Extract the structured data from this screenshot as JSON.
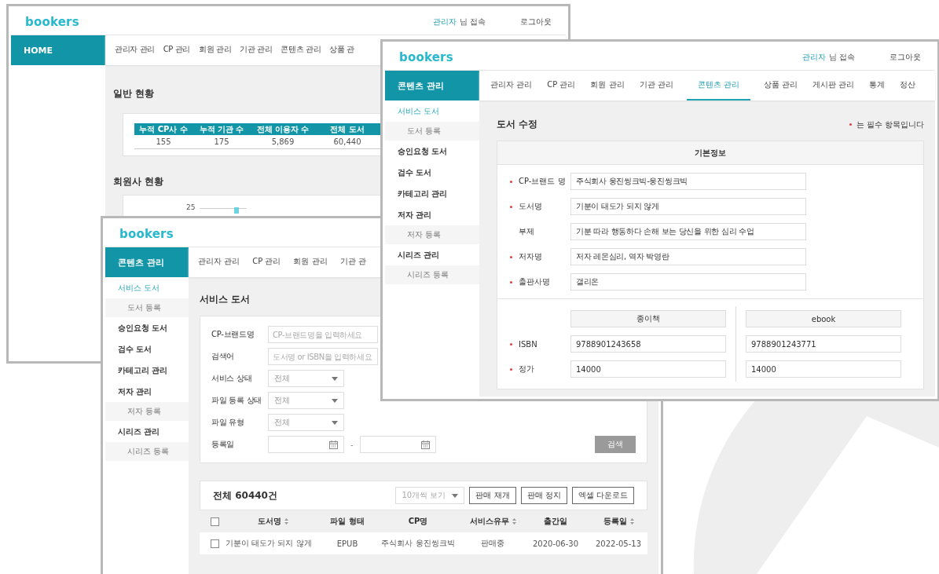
{
  "windows": [
    {
      "kind": "dashboard",
      "header": {
        "logo": "bookers",
        "user": "관리자",
        "user_suffix": "님 접속",
        "logout": "로그아웃"
      },
      "section_title": "HOME",
      "nav": [
        {
          "label": "관리자 관리",
          "selected": false
        },
        {
          "label": "CP 관리",
          "selected": false
        },
        {
          "label": "회원 관리",
          "selected": false
        },
        {
          "label": "기관 관리",
          "selected": false
        },
        {
          "label": "콘텐츠 관리",
          "selected": false
        },
        {
          "label": "상품 관",
          "selected": false
        }
      ],
      "general": {
        "title": "일반 현황",
        "columns": [
          "누적 CP사 수",
          "누적 기관 수",
          "전체 이용자 수",
          "전체 도서"
        ],
        "values": [
          "155",
          "175",
          "5,869",
          "60,440"
        ]
      },
      "members": {
        "title": "회원사 현황",
        "tick_label": "25"
      }
    },
    {
      "kind": "book_list",
      "header": {
        "logo": "bookers"
      },
      "section_title": "콘텐츠 관리",
      "nav": [
        {
          "label": "관리자 관리",
          "selected": false
        },
        {
          "label": "CP 관리",
          "selected": false
        },
        {
          "label": "회원 관리",
          "selected": false
        },
        {
          "label": "기관 관",
          "selected": false
        }
      ],
      "sidebar": [
        {
          "label": "서비스 도서",
          "selected": true,
          "children": [
            {
              "label": "도서 등록",
              "selected": false
            }
          ]
        },
        {
          "label": "승인요청 도서",
          "selected": false
        },
        {
          "label": "검수 도서",
          "selected": false
        },
        {
          "label": "카테고리 관리",
          "selected": false
        },
        {
          "label": "저자 관리",
          "selected": false,
          "children": [
            {
              "label": "저자 등록",
              "selected": false
            }
          ]
        },
        {
          "label": "시리즈 관리",
          "selected": false,
          "children": [
            {
              "label": "시리즈 등록",
              "selected": false
            }
          ]
        }
      ],
      "page_title": "서비스 도서",
      "filters": [
        {
          "kind": "text",
          "label": "CP-브랜드명",
          "placeholder": "CP-브랜드명을 입력하세요"
        },
        {
          "kind": "text",
          "label": "검색어",
          "placeholder": "도서명 or ISBN을 입력하세요"
        },
        {
          "kind": "select",
          "label": "서비스 상태",
          "value": "전체"
        },
        {
          "kind": "select",
          "label": "파일 등록 상태",
          "value": "전체"
        },
        {
          "kind": "select",
          "label": "파일 유형",
          "value": "전체"
        },
        {
          "kind": "date_range",
          "label": "등록일",
          "separator": "-"
        }
      ],
      "search_button": "검색",
      "list": {
        "total": "전체 60440건",
        "page_size": "10개씩 보기",
        "buttons": [
          "판매 재개",
          "판매 정지",
          "엑셀 다운로드"
        ],
        "header_checked": false,
        "columns": [
          {
            "label": "도서명",
            "sortable": true
          },
          {
            "label": "파일 형태",
            "sortable": false
          },
          {
            "label": "CP명",
            "sortable": false
          },
          {
            "label": "서비스유무",
            "sortable": true
          },
          {
            "label": "출간일",
            "sortable": false
          },
          {
            "label": "등록일",
            "sortable": true
          }
        ],
        "rows": [
          {
            "checked": false,
            "cells": [
              "기분이 태도가 되지 않게",
              "EPUB",
              "주식회사 웅진씽크빅",
              "판매중",
              "2020-06-30",
              "2022-05-13"
            ]
          }
        ]
      }
    },
    {
      "kind": "book_edit",
      "header": {
        "logo": "bookers",
        "user": "관리자",
        "user_suffix": "님 접속",
        "logout": "로그아웃"
      },
      "section_title": "콘텐츠 관리",
      "nav": [
        {
          "label": "관리자 관리",
          "selected": false
        },
        {
          "label": "CP 관리",
          "selected": false
        },
        {
          "label": "회원 관리",
          "selected": false
        },
        {
          "label": "기관 관리",
          "selected": false
        },
        {
          "label": "콘텐츠 관리",
          "selected": true
        },
        {
          "label": "상품 관리",
          "selected": false
        },
        {
          "label": "게시판 관리",
          "selected": false
        },
        {
          "label": "통계",
          "selected": false
        },
        {
          "label": "정산",
          "selected": false
        }
      ],
      "sidebar": [
        {
          "label": "서비스 도서",
          "selected": true,
          "children": [
            {
              "label": "도서 등록",
              "selected": false
            }
          ]
        },
        {
          "label": "승인요청 도서",
          "selected": false
        },
        {
          "label": "검수 도서",
          "selected": false
        },
        {
          "label": "카테고리 관리",
          "selected": false
        },
        {
          "label": "저자 관리",
          "selected": false,
          "children": [
            {
              "label": "저자 등록",
              "selected": false
            }
          ]
        },
        {
          "label": "시리즈 관리",
          "selected": false,
          "children": [
            {
              "label": "시리즈 등록",
              "selected": false
            }
          ]
        }
      ],
      "page_title": "도서 수정",
      "required_note": "는 필수 항목입니다",
      "basic": {
        "title": "기본정보",
        "fields": [
          {
            "label": "CP-브랜드 명",
            "required": true,
            "value": "주식회사 웅진씽크빅-웅진씽크빅"
          },
          {
            "label": "도서명",
            "required": true,
            "value": "기분이 태도가 되지 않게"
          },
          {
            "label": "부제",
            "required": false,
            "value": "기분 따라 행동하다 손해 보는 당신을 위한 심리 수업"
          },
          {
            "label": "저자명",
            "required": true,
            "value": "저자 레몬심리, 역자 박영란"
          },
          {
            "label": "출판사명",
            "required": true,
            "value": "갤리온"
          }
        ]
      },
      "formats": {
        "columns": [
          "종이책",
          "ebook"
        ],
        "rows": [
          {
            "label": "ISBN",
            "required": true,
            "values": [
              "9788901243658",
              "9788901243771"
            ]
          },
          {
            "label": "정가",
            "required": true,
            "values": [
              "14000",
              "14000"
            ]
          }
        ]
      }
    }
  ]
}
